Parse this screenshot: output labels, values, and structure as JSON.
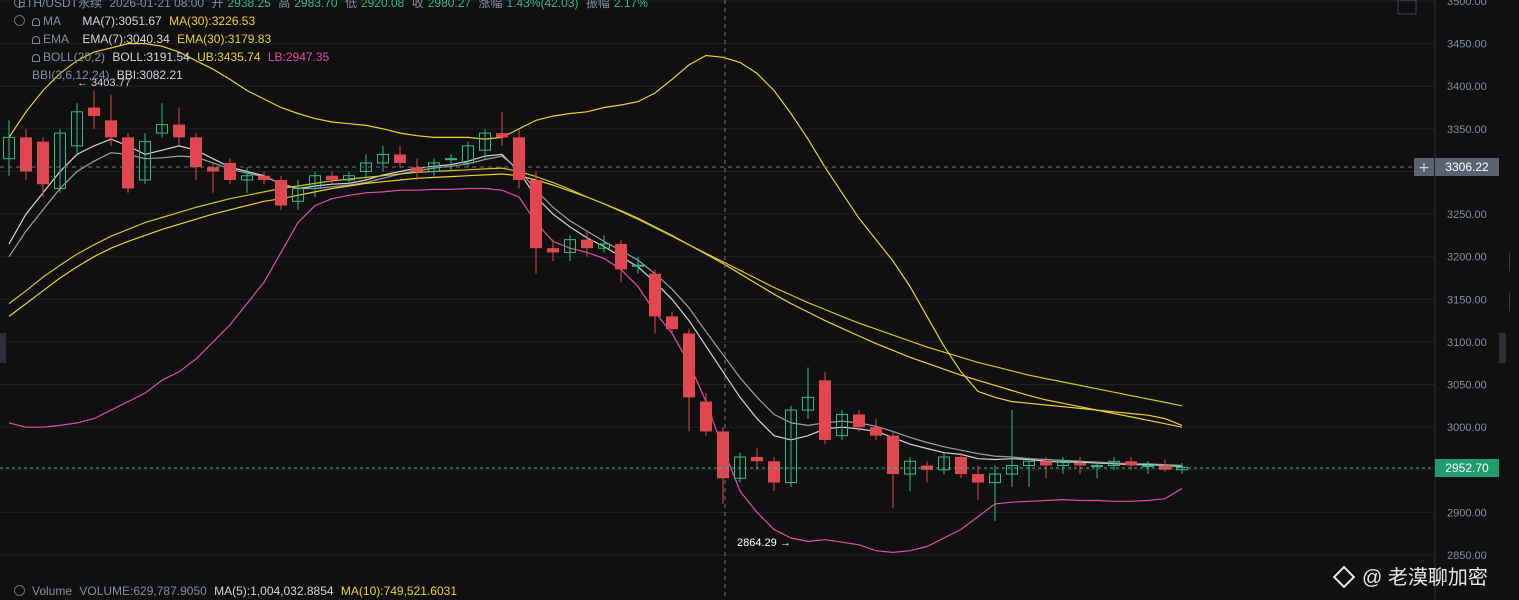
{
  "header": {
    "symbol": "ETH/USDT永续",
    "date": "2026-01-21 08:00",
    "open_label": "开",
    "open": "2938.25",
    "high_label": "高",
    "high": "2983.70",
    "low_label": "低",
    "low": "2920.08",
    "close_label": "收",
    "close": "2980.27",
    "change_label": "涨幅",
    "change": "1.43%(42.03)",
    "amp_label": "振幅",
    "amp": "2.17%"
  },
  "indicators": {
    "ma": {
      "name": "MA",
      "ma7": "MA(7):3051.67",
      "ma30": "MA(30):3226.53"
    },
    "ema": {
      "name": "EMA",
      "ema7": "EMA(7):3040.34",
      "ema30": "EMA(30):3179.83"
    },
    "boll": {
      "name": "BOLL(20,2)",
      "boll": "BOLL:3191.54",
      "ub": "UB:3435.74",
      "lb": "LB:2947.35"
    },
    "bbi": {
      "name": "BBI(3,6,12,24)",
      "bbi": "BBI:3082.21"
    }
  },
  "volume_bar": {
    "name": "Volume",
    "volume": "VOLUME:629,787.9050",
    "ma5": "MA(5):1,004,032.8854",
    "ma10": "MA(10):749,521.6031"
  },
  "markers": {
    "high": "← 3403.77",
    "low": "2864.29 →",
    "crosshair_price": "3306.22",
    "last_price": "2952.70"
  },
  "watermark": "@ 老漠聊加密",
  "colors": {
    "up": "#2ebd85",
    "down": "#e0474f",
    "ma7": "#d1d4dc",
    "ma30": "#f0d028",
    "boll_lb": "#e04bb0",
    "grid": "#1e2126",
    "last_price": "#2ebd85"
  },
  "chart_data": {
    "type": "candlestick",
    "y_range": [
      2850,
      3500
    ],
    "y_ticks": [
      "3500.00",
      "3450.00",
      "3400.00",
      "3350.00",
      "3300.00",
      "3250.00",
      "3200.00",
      "3150.00",
      "3100.00",
      "3050.00",
      "3000.00",
      "2950.00",
      "2900.00",
      "2850.00"
    ],
    "candles": [
      [
        3315,
        3360,
        3295,
        3340
      ],
      [
        3340,
        3350,
        3290,
        3300
      ],
      [
        3335,
        3340,
        3270,
        3285
      ],
      [
        3280,
        3350,
        3275,
        3345
      ],
      [
        3330,
        3380,
        3320,
        3370
      ],
      [
        3375,
        3395,
        3350,
        3365
      ],
      [
        3360,
        3390,
        3330,
        3340
      ],
      [
        3340,
        3345,
        3275,
        3280
      ],
      [
        3290,
        3345,
        3285,
        3335
      ],
      [
        3345,
        3380,
        3340,
        3355
      ],
      [
        3355,
        3375,
        3330,
        3340
      ],
      [
        3340,
        3345,
        3290,
        3305
      ],
      [
        3305,
        3310,
        3275,
        3300
      ],
      [
        3310,
        3315,
        3285,
        3290
      ],
      [
        3290,
        3305,
        3275,
        3295
      ],
      [
        3295,
        3300,
        3285,
        3290
      ],
      [
        3290,
        3295,
        3255,
        3260
      ],
      [
        3265,
        3290,
        3255,
        3280
      ],
      [
        3280,
        3300,
        3270,
        3295
      ],
      [
        3295,
        3300,
        3285,
        3290
      ],
      [
        3290,
        3300,
        3285,
        3295
      ],
      [
        3300,
        3320,
        3290,
        3310
      ],
      [
        3310,
        3330,
        3300,
        3320
      ],
      [
        3320,
        3330,
        3305,
        3310
      ],
      [
        3305,
        3315,
        3290,
        3300
      ],
      [
        3300,
        3315,
        3295,
        3310
      ],
      [
        3315,
        3320,
        3300,
        3315
      ],
      [
        3310,
        3335,
        3305,
        3330
      ],
      [
        3325,
        3350,
        3315,
        3345
      ],
      [
        3345,
        3370,
        3330,
        3340
      ],
      [
        3340,
        3350,
        3280,
        3290
      ],
      [
        3290,
        3300,
        3180,
        3210
      ],
      [
        3210,
        3220,
        3195,
        3205
      ],
      [
        3205,
        3225,
        3195,
        3220
      ],
      [
        3220,
        3230,
        3200,
        3210
      ],
      [
        3210,
        3225,
        3205,
        3215
      ],
      [
        3215,
        3220,
        3170,
        3185
      ],
      [
        3190,
        3200,
        3180,
        3190
      ],
      [
        3180,
        3185,
        3110,
        3130
      ],
      [
        3130,
        3135,
        3110,
        3115
      ],
      [
        3110,
        3115,
        2995,
        3035
      ],
      [
        3030,
        3040,
        2990,
        2995
      ],
      [
        2995,
        3000,
        2910,
        2940
      ],
      [
        2940,
        2970,
        2935,
        2965
      ],
      [
        2965,
        2975,
        2950,
        2960
      ],
      [
        2960,
        2965,
        2925,
        2935
      ],
      [
        2935,
        3025,
        2930,
        3020
      ],
      [
        3020,
        3070,
        3010,
        3035
      ],
      [
        3055,
        3065,
        2980,
        2985
      ],
      [
        2990,
        3020,
        2985,
        3015
      ],
      [
        3015,
        3020,
        2995,
        3000
      ],
      [
        3000,
        3010,
        2985,
        2990
      ],
      [
        2990,
        2995,
        2905,
        2945
      ],
      [
        2945,
        2965,
        2925,
        2960
      ],
      [
        2955,
        2960,
        2935,
        2950
      ],
      [
        2950,
        2970,
        2945,
        2965
      ],
      [
        2965,
        2970,
        2940,
        2945
      ],
      [
        2945,
        2955,
        2915,
        2935
      ],
      [
        2935,
        2955,
        2890,
        2945
      ],
      [
        2945,
        3020,
        2930,
        2955
      ],
      [
        2955,
        2965,
        2930,
        2960
      ],
      [
        2960,
        2965,
        2940,
        2955
      ],
      [
        2955,
        2965,
        2945,
        2960
      ],
      [
        2958,
        2965,
        2945,
        2955
      ],
      [
        2955,
        2960,
        2940,
        2955
      ],
      [
        2955,
        2965,
        2950,
        2960
      ],
      [
        2960,
        2965,
        2950,
        2955
      ],
      [
        2955,
        2960,
        2945,
        2955
      ],
      [
        2955,
        2962,
        2948,
        2950
      ],
      [
        2950,
        2958,
        2945,
        2953
      ]
    ],
    "series": [
      {
        "name": "MA(7)",
        "values": [
          3215,
          3250,
          3275,
          3300,
          3320,
          3330,
          3338,
          3330,
          3320,
          3325,
          3330,
          3325,
          3315,
          3305,
          3300,
          3295,
          3285,
          3280,
          3283,
          3285,
          3286,
          3290,
          3296,
          3300,
          3304,
          3306,
          3308,
          3312,
          3318,
          3320,
          3300,
          3270,
          3250,
          3235,
          3222,
          3212,
          3200,
          3188,
          3170,
          3150,
          3125,
          3095,
          3065,
          3035,
          3010,
          2990,
          2985,
          2990,
          2998,
          3000,
          2998,
          2995,
          2988,
          2980,
          2975,
          2970,
          2968,
          2963,
          2962,
          2963,
          2962,
          2960,
          2959,
          2959,
          2958,
          2957,
          2956,
          2956,
          2955,
          2954
        ]
      },
      {
        "name": "MA(7)-b",
        "values": [
          3200,
          3230,
          3255,
          3280,
          3300,
          3312,
          3322,
          3320,
          3315,
          3316,
          3318,
          3317,
          3310,
          3303,
          3298,
          3294,
          3286,
          3280,
          3280,
          3282,
          3284,
          3287,
          3292,
          3297,
          3301,
          3304,
          3306,
          3309,
          3314,
          3318,
          3302,
          3278,
          3258,
          3242,
          3230,
          3218,
          3207,
          3196,
          3180,
          3162,
          3140,
          3112,
          3085,
          3058,
          3035,
          3015,
          3005,
          3002,
          3005,
          3007,
          3005,
          3001,
          2995,
          2988,
          2982,
          2977,
          2973,
          2969,
          2966,
          2965,
          2963,
          2962,
          2961,
          2960,
          2959,
          2958,
          2957,
          2957,
          2956,
          2955
        ]
      },
      {
        "name": "MA(30)",
        "values": [
          3130,
          3145,
          3160,
          3175,
          3188,
          3200,
          3210,
          3218,
          3225,
          3232,
          3238,
          3244,
          3250,
          3255,
          3260,
          3265,
          3268,
          3272,
          3276,
          3280,
          3283,
          3286,
          3288,
          3290,
          3292,
          3293,
          3294,
          3295,
          3296,
          3297,
          3295,
          3290,
          3284,
          3277,
          3270,
          3262,
          3254,
          3245,
          3235,
          3225,
          3214,
          3203,
          3192,
          3180,
          3168,
          3156,
          3145,
          3135,
          3125,
          3116,
          3107,
          3098,
          3090,
          3082,
          3075,
          3068,
          3061,
          3055,
          3049,
          3043,
          3037,
          3032,
          3028,
          3024,
          3020,
          3016,
          3012,
          3008,
          3004,
          3000
        ]
      },
      {
        "name": "MA(30)-b",
        "values": [
          3145,
          3160,
          3176,
          3190,
          3203,
          3214,
          3224,
          3232,
          3240,
          3246,
          3252,
          3258,
          3263,
          3268,
          3272,
          3276,
          3280,
          3283,
          3286,
          3289,
          3291,
          3293,
          3295,
          3297,
          3299,
          3300,
          3301,
          3302,
          3303,
          3304,
          3300,
          3294,
          3287,
          3279,
          3270,
          3262,
          3253,
          3244,
          3234,
          3224,
          3214,
          3204,
          3194,
          3184,
          3174,
          3164,
          3155,
          3146,
          3138,
          3130,
          3122,
          3115,
          3108,
          3101,
          3094,
          3088,
          3082,
          3076,
          3071,
          3066,
          3061,
          3057,
          3053,
          3049,
          3045,
          3041,
          3037,
          3033,
          3029,
          3025
        ]
      },
      {
        "name": "UB",
        "values": [
          3340,
          3370,
          3395,
          3415,
          3430,
          3440,
          3445,
          3450,
          3450,
          3447,
          3440,
          3430,
          3420,
          3408,
          3395,
          3385,
          3375,
          3368,
          3362,
          3358,
          3356,
          3354,
          3350,
          3345,
          3342,
          3340,
          3340,
          3340,
          3338,
          3340,
          3350,
          3360,
          3365,
          3368,
          3370,
          3375,
          3378,
          3382,
          3392,
          3408,
          3425,
          3436,
          3434,
          3428,
          3415,
          3395,
          3368,
          3338,
          3305,
          3275,
          3245,
          3220,
          3195,
          3165,
          3130,
          3095,
          3065,
          3042,
          3035,
          3030,
          3028,
          3026,
          3024,
          3022,
          3020,
          3018,
          3016,
          3014,
          3010,
          3002
        ]
      },
      {
        "name": "LB",
        "values": [
          3005,
          3000,
          3000,
          3002,
          3005,
          3010,
          3020,
          3030,
          3040,
          3055,
          3065,
          3080,
          3100,
          3120,
          3145,
          3170,
          3205,
          3240,
          3260,
          3268,
          3272,
          3275,
          3276,
          3278,
          3278,
          3279,
          3279,
          3280,
          3280,
          3278,
          3270,
          3240,
          3218,
          3210,
          3205,
          3198,
          3185,
          3165,
          3135,
          3110,
          3075,
          3030,
          2975,
          2925,
          2900,
          2880,
          2870,
          2866,
          2868,
          2865,
          2862,
          2855,
          2853,
          2855,
          2860,
          2870,
          2880,
          2895,
          2910,
          2912,
          2913,
          2914,
          2915,
          2914,
          2914,
          2913,
          2913,
          2914,
          2916,
          2928
        ]
      }
    ]
  }
}
